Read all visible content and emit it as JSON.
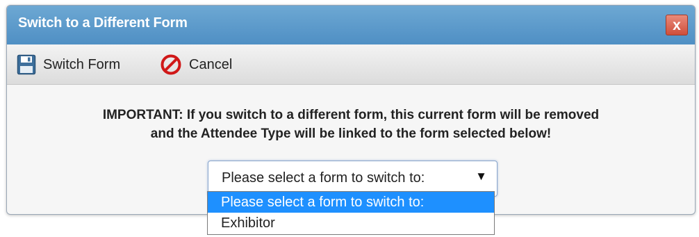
{
  "dialog": {
    "title": "Switch to a Different Form",
    "close_label": "x"
  },
  "toolbar": {
    "switch_label": "Switch Form",
    "cancel_label": "Cancel"
  },
  "message": {
    "line1": "IMPORTANT: If you switch to a different form, this current form will be removed",
    "line2": "and the Attendee Type will be linked to the form selected below!"
  },
  "form_select": {
    "selected_value": "Please select a form to switch to:",
    "options": [
      "Please select a form to switch to:",
      "Exhibitor"
    ]
  },
  "icons": {
    "save": "floppy-disk-icon",
    "cancel": "no-entry-icon",
    "dropdown": "caret-down-icon"
  },
  "colors": {
    "titlebar": "#5a9bcc",
    "close_button": "#d9624e",
    "selected_option": "#1e90ff",
    "cancel_icon": "#d01818"
  }
}
